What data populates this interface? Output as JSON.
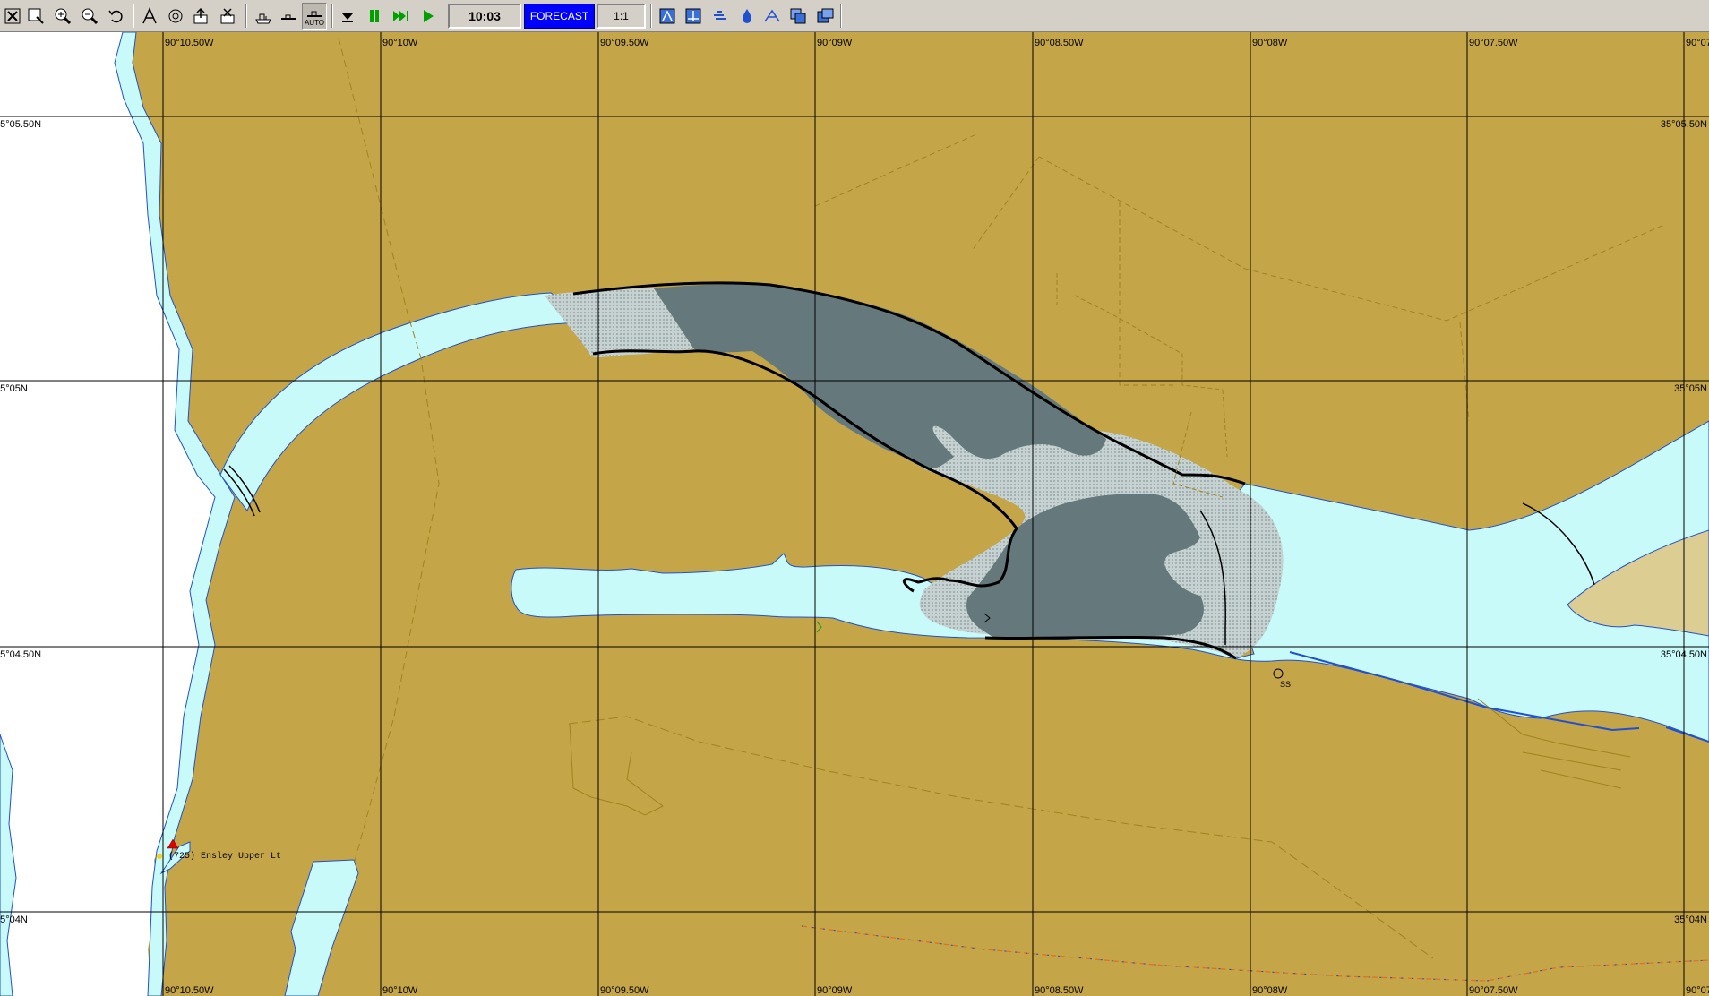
{
  "toolbar": {
    "time": "10:03",
    "forecast_label": "FORECAST",
    "scale": "1:1",
    "auto_label": "AUTO"
  },
  "chart": {
    "longitude_labels": [
      "90°10.50W",
      "90°10W",
      "90°09.50W",
      "90°09W",
      "90°08.50W",
      "90°08W",
      "90°07.50W",
      "90°07"
    ],
    "latitude_labels": [
      "35°05.50N",
      "35°05N",
      "35°04.50N",
      "35°04N"
    ],
    "feature_labels": {
      "light": "(725) Ensley Upper Lt",
      "buoy": "SS"
    },
    "colors": {
      "land": "#c4a547",
      "water": "#c8fafa",
      "deep_shoal": "#65797c",
      "shallow_shoal": "#c6d2d2",
      "tan_area": "#dccd93"
    }
  }
}
